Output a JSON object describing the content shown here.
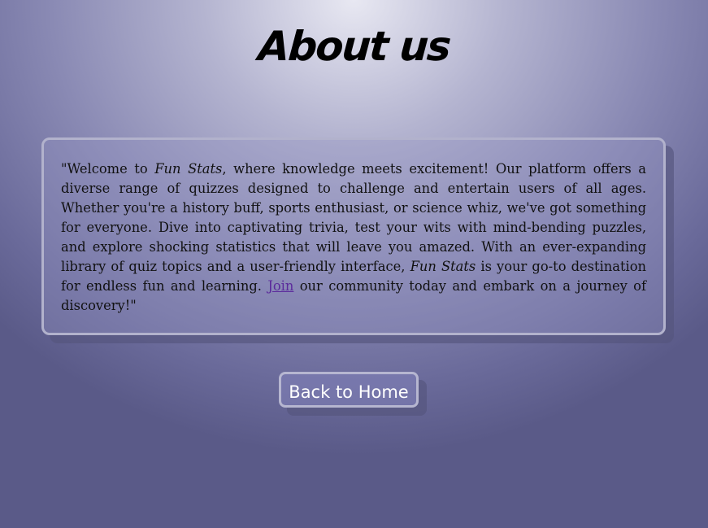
{
  "page": {
    "title": "About us"
  },
  "about": {
    "intro": "\"Welcome to ",
    "brand": "Fun Stats",
    "part2": ", where knowledge meets excitement! Our platform offers a diverse range of quizzes designed to challenge and entertain users of all ages. Whether you're a history buff, sports enthusiast, or science whiz, we've got something for everyone. Dive into captivating trivia, test your wits with mind-bending puzzles, and explore shocking statistics that will leave you amazed. With an ever-expanding library of quiz topics and a user-friendly interface, ",
    "brand2": "Fun Stats",
    "part3": " is your go-to destination for endless fun and learning. ",
    "join_link": "Join",
    "part4": " our community today and embark on a journey of discovery!\""
  },
  "nav": {
    "back_home": "Back to Home"
  },
  "colors": {
    "link": "#5b2a9c",
    "card_border": "#b2b2cc"
  }
}
